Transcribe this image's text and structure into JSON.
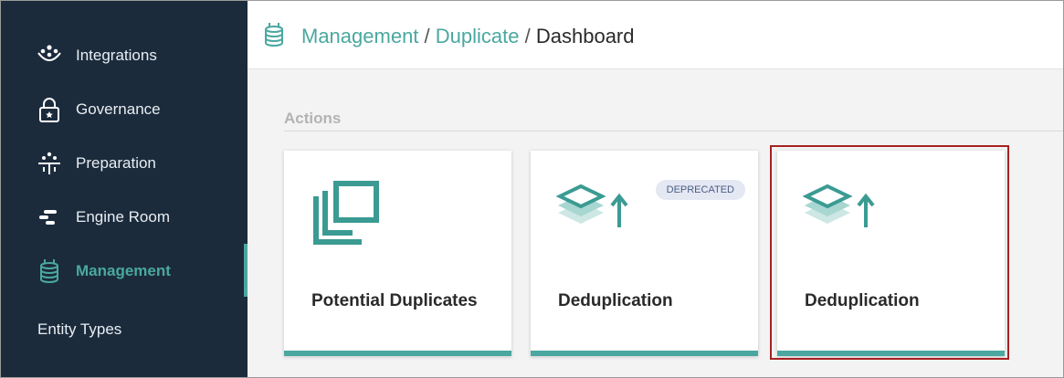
{
  "sidebar": {
    "items": [
      {
        "label": "Integrations",
        "icon": "integrations-icon"
      },
      {
        "label": "Governance",
        "icon": "governance-lock-icon"
      },
      {
        "label": "Preparation",
        "icon": "preparation-icon"
      },
      {
        "label": "Engine Room",
        "icon": "engine-room-icon"
      },
      {
        "label": "Management",
        "icon": "management-database-icon",
        "active": true
      }
    ],
    "sub_link": "Entity Types"
  },
  "breadcrumb": {
    "icon": "database-icon",
    "items": [
      "Management",
      "Duplicate",
      "Dashboard"
    ],
    "separator": "/"
  },
  "actions": {
    "title": "Actions",
    "cards": [
      {
        "title": "Potential Duplicates",
        "icon": "duplicates-icon"
      },
      {
        "title": "Deduplication",
        "icon": "layers-up-icon",
        "badge": "DEPRECATED"
      },
      {
        "title": "Deduplication",
        "icon": "layers-up-icon",
        "highlighted": true
      }
    ]
  },
  "colors": {
    "sidebar_bg": "#1b2b3c",
    "accent": "#4aa8a0",
    "highlight_border": "#a62121"
  }
}
